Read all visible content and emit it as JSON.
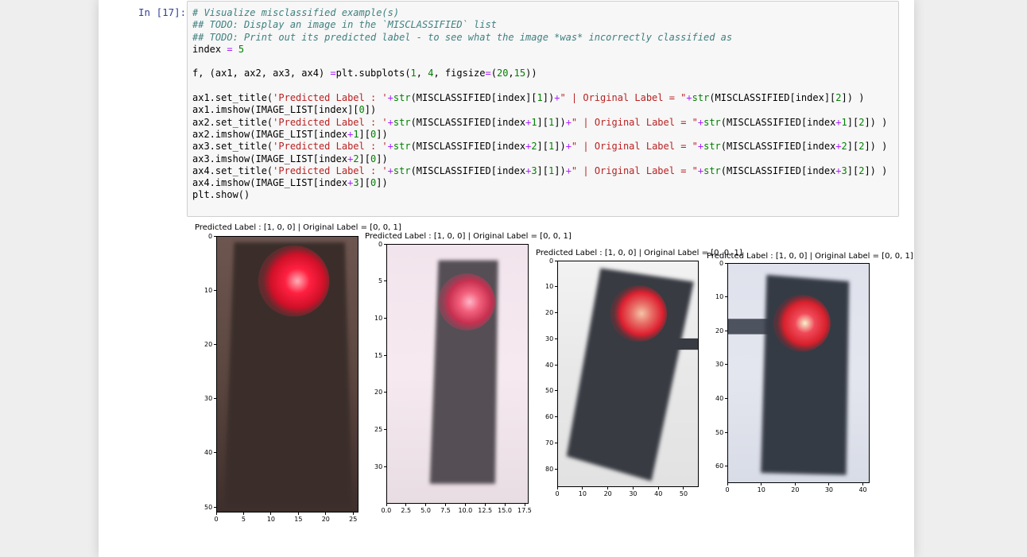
{
  "cell": {
    "prompt": "In [17]:",
    "code_lines": [
      [
        [
          "cm",
          "# Visualize misclassified example(s)"
        ]
      ],
      [
        [
          "cm",
          "## TODO: Display an image in the `MISCLASSIFIED` list"
        ]
      ],
      [
        [
          "cm",
          "## TODO: Print out its predicted label - to see what the image *was* incorrectly classified as"
        ]
      ],
      [
        [
          "",
          "index "
        ],
        [
          "op",
          "="
        ],
        [
          "nm",
          " 5"
        ]
      ],
      [],
      [
        [
          "",
          "f, (ax1, ax2, ax3, ax4) "
        ],
        [
          "op",
          "="
        ],
        [
          "",
          "plt.subplots("
        ],
        [
          "nm",
          "1"
        ],
        [
          "",
          ", "
        ],
        [
          "nm",
          "4"
        ],
        [
          "",
          ", figsize"
        ],
        [
          "op",
          "="
        ],
        [
          "",
          "("
        ],
        [
          "nm",
          "20"
        ],
        [
          "",
          ","
        ],
        [
          "nm",
          "15"
        ],
        [
          "",
          "))"
        ]
      ],
      [],
      [
        [
          "",
          "ax1.set_title("
        ],
        [
          "st",
          "'Predicted Label : '"
        ],
        [
          "op",
          "+"
        ],
        [
          "bi",
          "str"
        ],
        [
          "",
          "(MISCLASSIFIED[index]["
        ],
        [
          "nm",
          "1"
        ],
        [
          "",
          "])"
        ],
        [
          "op",
          "+"
        ],
        [
          "st",
          "\" | Original Label = \""
        ],
        [
          "op",
          "+"
        ],
        [
          "bi",
          "str"
        ],
        [
          "",
          "(MISCLASSIFIED[index]["
        ],
        [
          "nm",
          "2"
        ],
        [
          "",
          "]) )"
        ]
      ],
      [
        [
          "",
          "ax1.imshow(IMAGE_LIST[index]["
        ],
        [
          "nm",
          "0"
        ],
        [
          "",
          "])"
        ]
      ],
      [
        [
          "",
          "ax2.set_title("
        ],
        [
          "st",
          "'Predicted Label : '"
        ],
        [
          "op",
          "+"
        ],
        [
          "bi",
          "str"
        ],
        [
          "",
          "(MISCLASSIFIED[index"
        ],
        [
          "op",
          "+"
        ],
        [
          "nm",
          "1"
        ],
        [
          "",
          "]["
        ],
        [
          "nm",
          "1"
        ],
        [
          "",
          "])"
        ],
        [
          "op",
          "+"
        ],
        [
          "st",
          "\" | Original Label = \""
        ],
        [
          "op",
          "+"
        ],
        [
          "bi",
          "str"
        ],
        [
          "",
          "(MISCLASSIFIED[index"
        ],
        [
          "op",
          "+"
        ],
        [
          "nm",
          "1"
        ],
        [
          "",
          "]["
        ],
        [
          "nm",
          "2"
        ],
        [
          "",
          "]) )"
        ]
      ],
      [
        [
          "",
          "ax2.imshow(IMAGE_LIST[index"
        ],
        [
          "op",
          "+"
        ],
        [
          "nm",
          "1"
        ],
        [
          "",
          "]["
        ],
        [
          "nm",
          "0"
        ],
        [
          "",
          "])"
        ]
      ],
      [
        [
          "",
          "ax3.set_title("
        ],
        [
          "st",
          "'Predicted Label : '"
        ],
        [
          "op",
          "+"
        ],
        [
          "bi",
          "str"
        ],
        [
          "",
          "(MISCLASSIFIED[index"
        ],
        [
          "op",
          "+"
        ],
        [
          "nm",
          "2"
        ],
        [
          "",
          "]["
        ],
        [
          "nm",
          "1"
        ],
        [
          "",
          "])"
        ],
        [
          "op",
          "+"
        ],
        [
          "st",
          "\" | Original Label = \""
        ],
        [
          "op",
          "+"
        ],
        [
          "bi",
          "str"
        ],
        [
          "",
          "(MISCLASSIFIED[index"
        ],
        [
          "op",
          "+"
        ],
        [
          "nm",
          "2"
        ],
        [
          "",
          "]["
        ],
        [
          "nm",
          "2"
        ],
        [
          "",
          "]) )"
        ]
      ],
      [
        [
          "",
          "ax3.imshow(IMAGE_LIST[index"
        ],
        [
          "op",
          "+"
        ],
        [
          "nm",
          "2"
        ],
        [
          "",
          "]["
        ],
        [
          "nm",
          "0"
        ],
        [
          "",
          "])"
        ]
      ],
      [
        [
          "",
          "ax4.set_title("
        ],
        [
          "st",
          "'Predicted Label : '"
        ],
        [
          "op",
          "+"
        ],
        [
          "bi",
          "str"
        ],
        [
          "",
          "(MISCLASSIFIED[index"
        ],
        [
          "op",
          "+"
        ],
        [
          "nm",
          "3"
        ],
        [
          "",
          "]["
        ],
        [
          "nm",
          "1"
        ],
        [
          "",
          "])"
        ],
        [
          "op",
          "+"
        ],
        [
          "st",
          "\" | Original Label = \""
        ],
        [
          "op",
          "+"
        ],
        [
          "bi",
          "str"
        ],
        [
          "",
          "(MISCLASSIFIED[index"
        ],
        [
          "op",
          "+"
        ],
        [
          "nm",
          "3"
        ],
        [
          "",
          "]["
        ],
        [
          "nm",
          "2"
        ],
        [
          "",
          "]) )"
        ]
      ],
      [
        [
          "",
          "ax4.imshow(IMAGE_LIST[index"
        ],
        [
          "op",
          "+"
        ],
        [
          "nm",
          "3"
        ],
        [
          "",
          "]["
        ],
        [
          "nm",
          "0"
        ],
        [
          "",
          "])"
        ]
      ],
      [
        [
          "",
          "plt.show()"
        ]
      ]
    ]
  },
  "output": {
    "plots": [
      {
        "title": "Predicted Label : [1, 0, 0] | Original Label = [0, 0, 1]",
        "xlim": [
          0,
          26
        ],
        "ylim": [
          0,
          51
        ],
        "xticks": [
          0,
          5,
          10,
          15,
          20,
          25
        ],
        "yticks": [
          0,
          10,
          20,
          30,
          40,
          50
        ],
        "xtick_labels": [
          "0",
          "5",
          "10",
          "15",
          "20",
          "25"
        ],
        "ytick_labels": [
          "0",
          "10",
          "20",
          "30",
          "40",
          "50"
        ],
        "image": {
          "bg": [
            "#6e5650",
            "#5c4640",
            "#3e2f2c"
          ],
          "housing": "#3a2e2b",
          "light": {
            "cx": 0.54,
            "cy": 0.16,
            "r": 0.25
          },
          "light_colors": [
            "#ffb0b8",
            "#ff2040",
            "#d01028",
            "#7a2a30"
          ]
        }
      },
      {
        "title": "Predicted Label : [1, 0, 0] | Original Label = [0, 0, 1]",
        "xlim": [
          0,
          18
        ],
        "ylim": [
          0,
          35
        ],
        "xticks": [
          0,
          2.5,
          5,
          7.5,
          10,
          12.5,
          15,
          17.5
        ],
        "yticks": [
          0,
          5,
          10,
          15,
          20,
          25,
          30
        ],
        "xtick_labels": [
          "0.0",
          "2.5",
          "5.0",
          "7.5",
          "10.0",
          "12.5",
          "15.0",
          "17.5"
        ],
        "ytick_labels": [
          "0",
          "5",
          "10",
          "15",
          "20",
          "25",
          "30"
        ],
        "image": {
          "bg": [
            "#f2e4ec",
            "#f6eaf0",
            "#e8dde2"
          ],
          "housing": "#555055",
          "light": {
            "cx": 0.56,
            "cy": 0.22,
            "r": 0.2
          },
          "light_colors": [
            "#ffb6c8",
            "#f2607c",
            "#c83050",
            "#a04058"
          ]
        }
      },
      {
        "title": "Predicted Label : [1, 0, 0] | Original Label = [0, 0, 1]",
        "xlim": [
          0,
          56
        ],
        "ylim": [
          0,
          87
        ],
        "xticks": [
          0,
          10,
          20,
          30,
          40,
          50
        ],
        "yticks": [
          0,
          10,
          20,
          30,
          40,
          50,
          60,
          70,
          80
        ],
        "xtick_labels": [
          "0",
          "10",
          "20",
          "30",
          "40",
          "50"
        ],
        "ytick_labels": [
          "0",
          "10",
          "20",
          "30",
          "40",
          "50",
          "60",
          "70",
          "80"
        ],
        "image": {
          "bg": [
            "#f2f2f2",
            "#e8e8e8",
            "#e2e2e2"
          ],
          "housing": "#383b42",
          "light": {
            "cx": 0.57,
            "cy": 0.23,
            "r": 0.2
          },
          "light_colors": [
            "#f4c4a8",
            "#e87068",
            "#dd2030",
            "#6a3036"
          ]
        }
      },
      {
        "title": "Predicted Label : [1, 0, 0] | Original Label = [0, 0, 1]",
        "xlim": [
          0,
          42
        ],
        "ylim": [
          0,
          65
        ],
        "xticks": [
          0,
          10,
          20,
          30,
          40
        ],
        "yticks": [
          0,
          10,
          20,
          30,
          40,
          50,
          60
        ],
        "xtick_labels": [
          "0",
          "10",
          "20",
          "30",
          "40"
        ],
        "ytick_labels": [
          "0",
          "10",
          "20",
          "30",
          "40",
          "50",
          "60"
        ],
        "image": {
          "bg": [
            "#dfe2ec",
            "#e4e6ef",
            "#d8dce6"
          ],
          "housing": "#363a44",
          "light": {
            "cx": 0.52,
            "cy": 0.27,
            "r": 0.2
          },
          "light_colors": [
            "#f6f2cc",
            "#f04858",
            "#d8202c",
            "#6a2e36"
          ]
        }
      }
    ]
  }
}
